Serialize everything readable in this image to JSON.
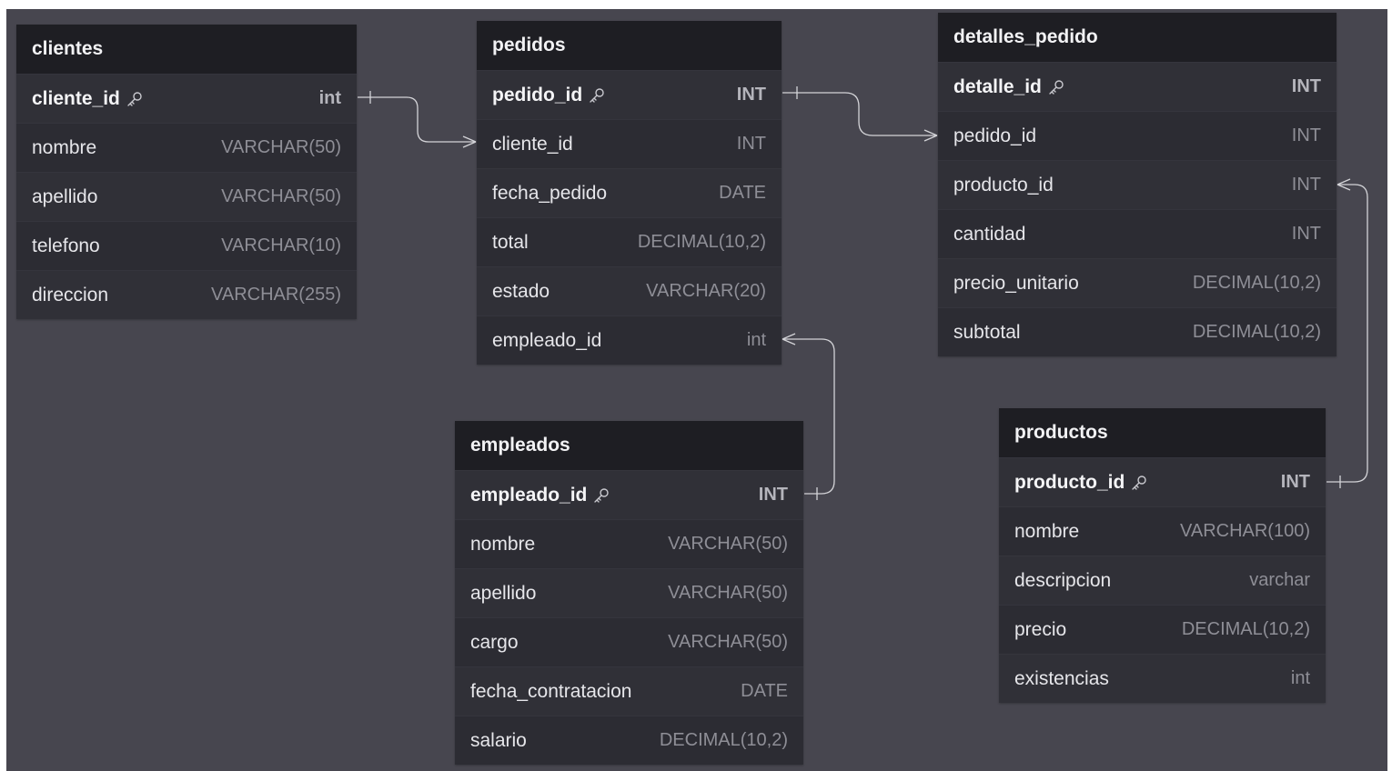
{
  "tables": {
    "clientes": {
      "name": "clientes",
      "fields": [
        {
          "name": "cliente_id",
          "type": "int",
          "pk": true
        },
        {
          "name": "nombre",
          "type": "VARCHAR(50)"
        },
        {
          "name": "apellido",
          "type": "VARCHAR(50)"
        },
        {
          "name": "telefono",
          "type": "VARCHAR(10)"
        },
        {
          "name": "direccion",
          "type": "VARCHAR(255)"
        }
      ]
    },
    "pedidos": {
      "name": "pedidos",
      "fields": [
        {
          "name": "pedido_id",
          "type": "INT",
          "pk": true
        },
        {
          "name": "cliente_id",
          "type": "INT"
        },
        {
          "name": "fecha_pedido",
          "type": "DATE"
        },
        {
          "name": "total",
          "type": "DECIMAL(10,2)"
        },
        {
          "name": "estado",
          "type": "VARCHAR(20)"
        },
        {
          "name": "empleado_id",
          "type": "int"
        }
      ]
    },
    "detalles_pedido": {
      "name": "detalles_pedido",
      "fields": [
        {
          "name": "detalle_id",
          "type": "INT",
          "pk": true
        },
        {
          "name": "pedido_id",
          "type": "INT"
        },
        {
          "name": "producto_id",
          "type": "INT"
        },
        {
          "name": "cantidad",
          "type": "INT"
        },
        {
          "name": "precio_unitario",
          "type": "DECIMAL(10,2)"
        },
        {
          "name": "subtotal",
          "type": "DECIMAL(10,2)"
        }
      ]
    },
    "empleados": {
      "name": "empleados",
      "fields": [
        {
          "name": "empleado_id",
          "type": "INT",
          "pk": true
        },
        {
          "name": "nombre",
          "type": "VARCHAR(50)"
        },
        {
          "name": "apellido",
          "type": "VARCHAR(50)"
        },
        {
          "name": "cargo",
          "type": "VARCHAR(50)"
        },
        {
          "name": "fecha_contratacion",
          "type": "DATE"
        },
        {
          "name": "salario",
          "type": "DECIMAL(10,2)"
        }
      ]
    },
    "productos": {
      "name": "productos",
      "fields": [
        {
          "name": "producto_id",
          "type": "INT",
          "pk": true
        },
        {
          "name": "nombre",
          "type": "VARCHAR(100)"
        },
        {
          "name": "descripcion",
          "type": "varchar"
        },
        {
          "name": "precio",
          "type": "DECIMAL(10,2)"
        },
        {
          "name": "existencias",
          "type": "int"
        }
      ]
    }
  },
  "relationships": [
    {
      "from": "clientes.cliente_id",
      "to": "pedidos.cliente_id",
      "cardinality": "one-to-many"
    },
    {
      "from": "pedidos.pedido_id",
      "to": "detalles_pedido.pedido_id",
      "cardinality": "one-to-many"
    },
    {
      "from": "empleados.empleado_id",
      "to": "pedidos.empleado_id",
      "cardinality": "one-to-many"
    },
    {
      "from": "productos.producto_id",
      "to": "detalles_pedido.producto_id",
      "cardinality": "one-to-many"
    }
  ],
  "icons": {
    "primary_key": "key-icon"
  },
  "colors": {
    "canvas": "#47464f",
    "table_header": "#1e1e23",
    "table_body": "#2c2c33",
    "link": "#d4d4d8"
  }
}
